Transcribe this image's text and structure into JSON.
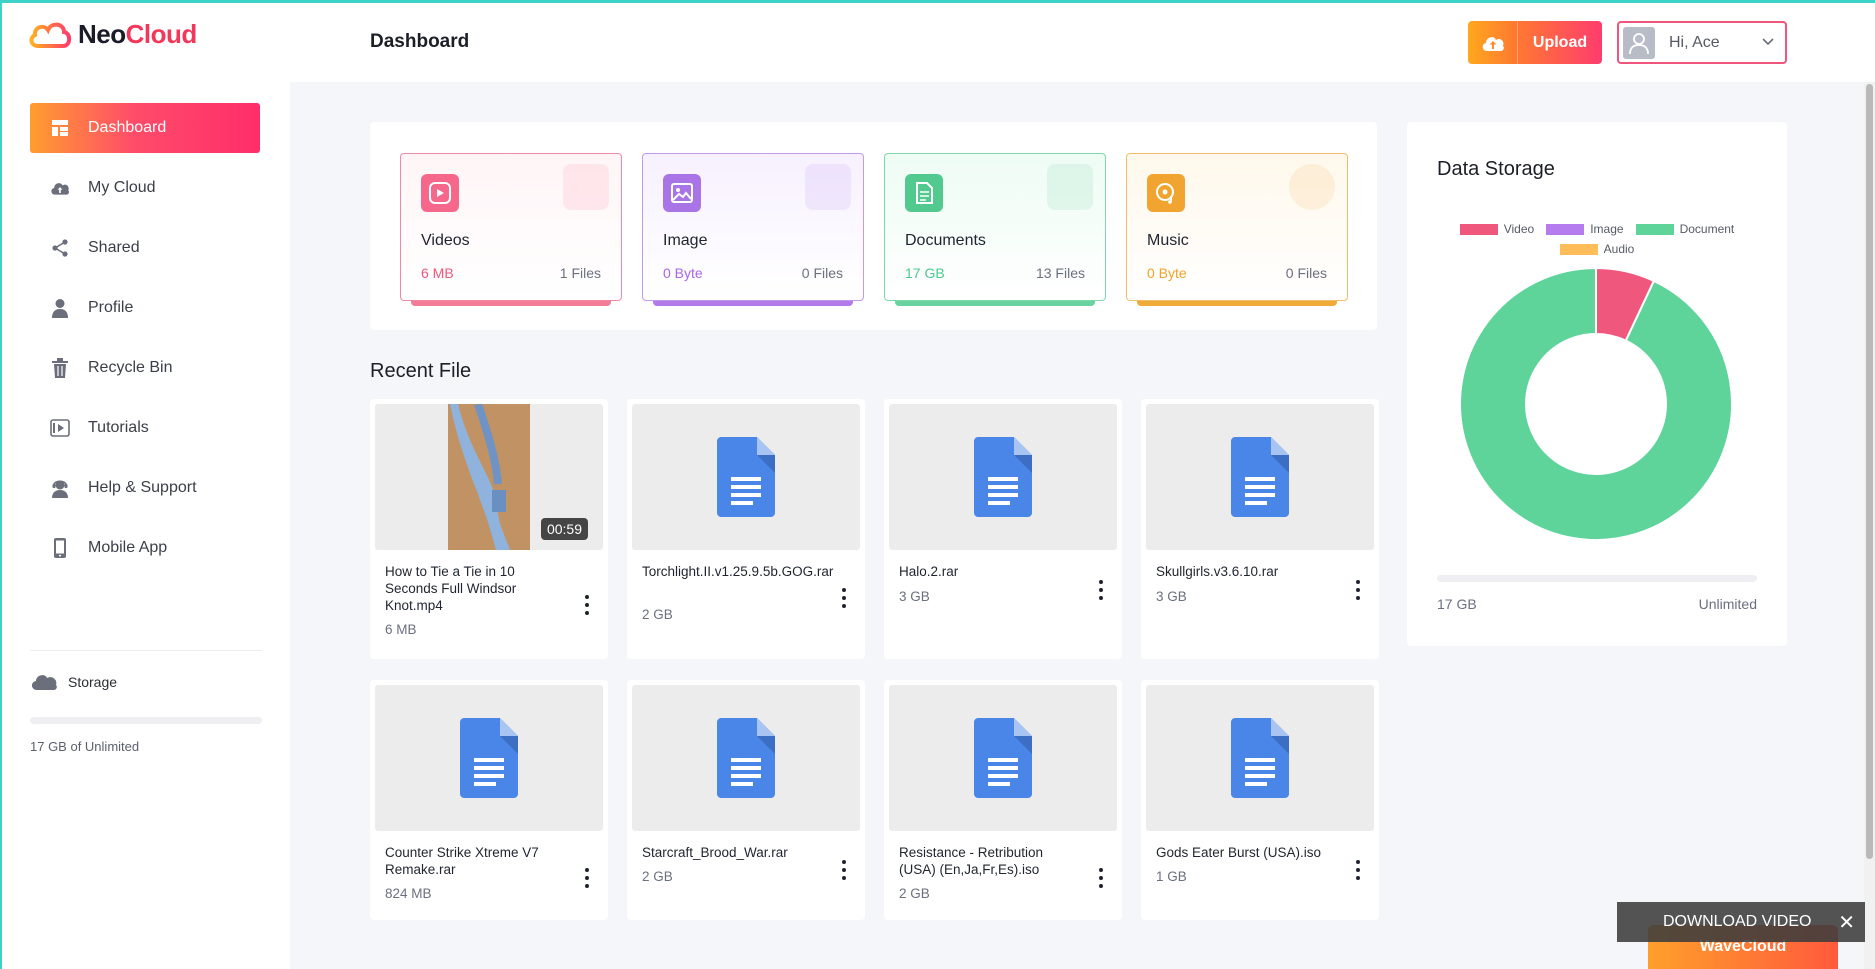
{
  "app": {
    "logo_neo": "Neo",
    "logo_cloud": "Cloud"
  },
  "sidebar": {
    "items": [
      {
        "label": "Dashboard",
        "icon": "dashboard-icon",
        "active": true
      },
      {
        "label": "My Cloud",
        "icon": "cloud-upload-icon"
      },
      {
        "label": "Shared",
        "icon": "share-icon"
      },
      {
        "label": "Profile",
        "icon": "user-icon"
      },
      {
        "label": "Recycle Bin",
        "icon": "trash-icon"
      },
      {
        "label": "Tutorials",
        "icon": "tutorial-icon"
      },
      {
        "label": "Help & Support",
        "icon": "support-agent-icon"
      },
      {
        "label": "Mobile App",
        "icon": "mobile-icon"
      }
    ],
    "storage_label": "Storage",
    "storage_text": "17 GB of Unlimited"
  },
  "header": {
    "title": "Dashboard",
    "upload_label": "Upload",
    "greeting": "Hi, Ace"
  },
  "categories": [
    {
      "name": "Videos",
      "size": "6 MB",
      "count": "1 Files",
      "color": "#f0577d"
    },
    {
      "name": "Image",
      "size": "0 Byte",
      "count": "0 Files",
      "color": "#a866e8"
    },
    {
      "name": "Documents",
      "size": "17 GB",
      "count": "13 Files",
      "color": "#4cc98f"
    },
    {
      "name": "Music",
      "size": "0 Byte",
      "count": "0 Files",
      "color": "#f0a22a"
    }
  ],
  "recent": {
    "title": "Recent File",
    "files": [
      {
        "name": "How to Tie a Tie in 10 Seconds Full Windsor Knot.mp4",
        "size": "6 MB",
        "type": "video",
        "duration": "00:59"
      },
      {
        "name": "Torchlight.II.v1.25.9.5b.GOG.rar",
        "size": "2 GB",
        "type": "doc"
      },
      {
        "name": "Halo.2.rar",
        "size": "3 GB",
        "type": "doc"
      },
      {
        "name": "Skullgirls.v3.6.10.rar",
        "size": "3 GB",
        "type": "doc"
      },
      {
        "name": "Counter Strike Xtreme V7 Remake.rar",
        "size": "824 MB",
        "type": "doc"
      },
      {
        "name": "Starcraft_Brood_War.rar",
        "size": "2 GB",
        "type": "doc"
      },
      {
        "name": "Resistance - Retribution (USA) (En,Ja,Fr,Es).iso",
        "size": "2 GB",
        "type": "doc"
      },
      {
        "name": "Gods Eater Burst (USA).iso",
        "size": "1 GB",
        "type": "doc"
      }
    ]
  },
  "storage_panel": {
    "title": "Data Storage",
    "used": "17 GB",
    "capacity": "Unlimited"
  },
  "chart_data": {
    "type": "pie",
    "title": "Data Storage",
    "categories": [
      "Video",
      "Image",
      "Document",
      "Audio"
    ],
    "values": [
      7,
      0,
      93,
      0
    ],
    "colors": [
      "#f0577d",
      "#b57cf0",
      "#5ed49b",
      "#ffbd5a"
    ],
    "legend": "top"
  },
  "overlay": {
    "download_label": "DOWNLOAD VIDEO",
    "close": "✕",
    "brand": "WaveCloud"
  }
}
